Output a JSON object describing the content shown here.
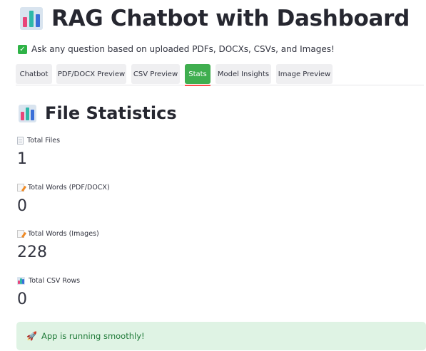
{
  "app": {
    "title": "RAG Chatbot with Dashboard",
    "title_icon": "bar-chart-icon"
  },
  "notice": {
    "icon": "check-box-icon",
    "text": "Ask any question based on uploaded PDFs, DOCXs, CSVs, and Images!"
  },
  "tabs": [
    {
      "label": "Chatbot",
      "active": false
    },
    {
      "label": "PDF/DOCX Preview",
      "active": false
    },
    {
      "label": "CSV Preview",
      "active": false
    },
    {
      "label": "Stats",
      "active": true
    },
    {
      "label": "Model Insights",
      "active": false
    },
    {
      "label": "Image Preview",
      "active": false
    }
  ],
  "section": {
    "title": "File Statistics",
    "icon": "bar-chart-icon"
  },
  "metrics": [
    {
      "label": "Total Files",
      "value": "1",
      "icon": "document-icon"
    },
    {
      "label": "Total Words (PDF/DOCX)",
      "value": "0",
      "icon": "memo-icon"
    },
    {
      "label": "Total Words (Images)",
      "value": "228",
      "icon": "memo-icon"
    },
    {
      "label": "Total CSV Rows",
      "value": "0",
      "icon": "bar-chart-icon"
    }
  ],
  "status": {
    "icon": "rocket-icon",
    "text": "App is running smoothly!"
  },
  "colors": {
    "active_tab": "#3fae4f",
    "tab_underline": "#ff4b4b",
    "success_bg": "#dff3e4",
    "success_text": "#1f7a38"
  }
}
